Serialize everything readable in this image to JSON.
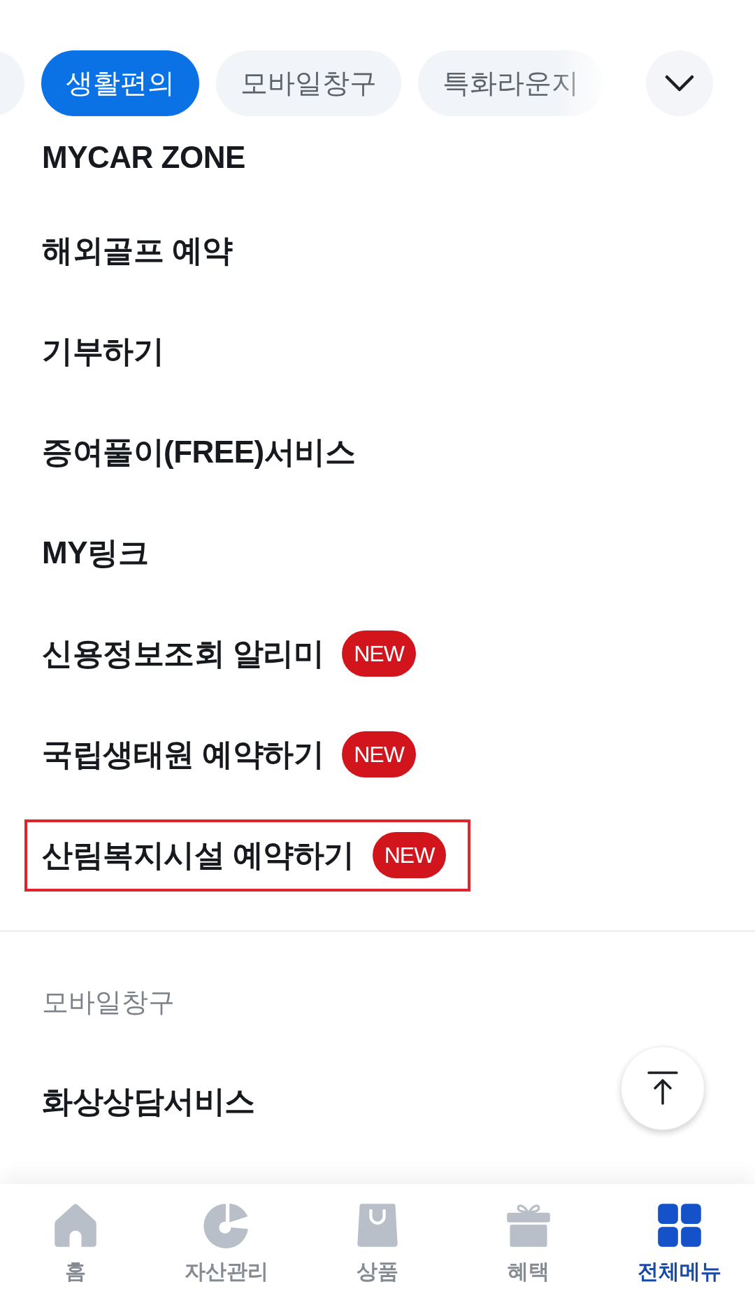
{
  "category_tabs": [
    {
      "label": "생활편의",
      "selected": true
    },
    {
      "label": "모바일창구",
      "selected": false
    },
    {
      "label": "특화라운지",
      "selected": false
    }
  ],
  "sections": [
    {
      "items": [
        {
          "label": "MYCAR ZONE",
          "highlighted": false
        },
        {
          "label": "해외골프 예약",
          "highlighted": false
        },
        {
          "label": "기부하기",
          "highlighted": false
        },
        {
          "label": "증여풀이(FREE)서비스",
          "highlighted": false
        },
        {
          "label": "MY링크",
          "highlighted": false
        },
        {
          "label": "신용정보조회 알리미",
          "badge": "NEW",
          "highlighted": false
        },
        {
          "label": "국립생태원 예약하기",
          "badge": "NEW",
          "highlighted": false
        },
        {
          "label": "산림복지시설 예약하기",
          "badge": "NEW",
          "highlighted": true
        }
      ]
    },
    {
      "title": "모바일창구",
      "items": [
        {
          "label": "화상상담서비스",
          "highlighted": false
        }
      ]
    }
  ],
  "bottom_nav": [
    {
      "label": "홈",
      "selected": false
    },
    {
      "label": "자산관리",
      "selected": false
    },
    {
      "label": "상품",
      "selected": false
    },
    {
      "label": "혜택",
      "selected": false
    },
    {
      "label": "전체메뉴",
      "selected": true
    }
  ]
}
